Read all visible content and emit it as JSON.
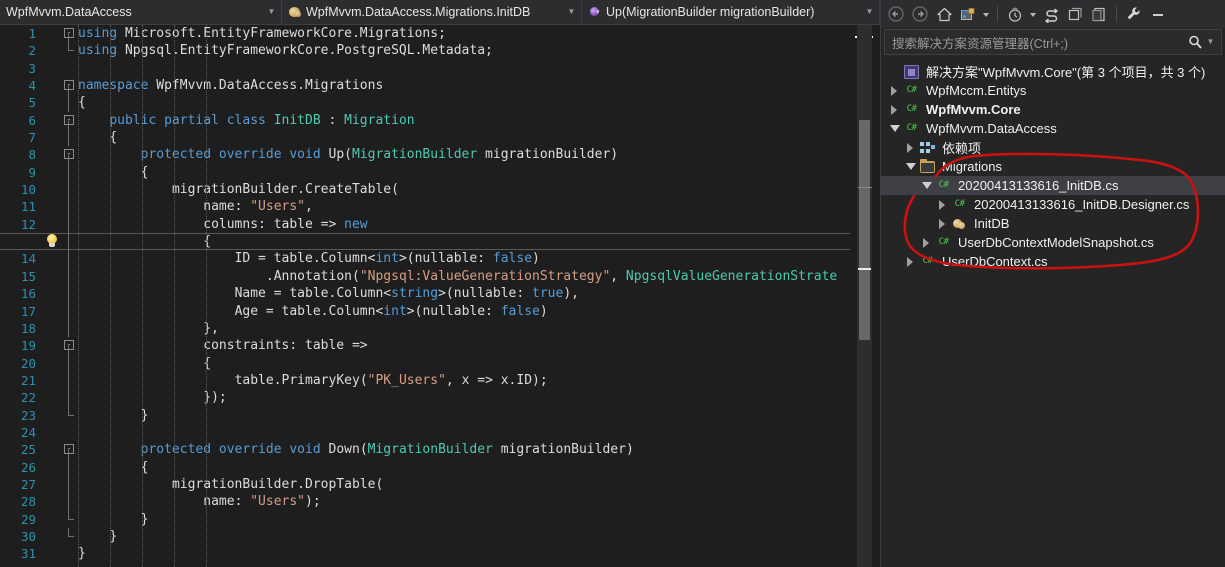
{
  "navbar": {
    "project_dropdown": "WpfMvvm.DataAccess",
    "type_dropdown": "WpfMvvm.DataAccess.Migrations.InitDB",
    "member_dropdown": "Up(MigrationBuilder migrationBuilder)",
    "accent_color": "#007acc"
  },
  "editor": {
    "language": "csharp",
    "current_line": 13,
    "background": "#1e1e1e",
    "line_number_color": "#2b91af",
    "colors": {
      "keyword": "#569cd6",
      "type": "#4ec9b0",
      "string": "#d69d85",
      "plain": "#dcdcdc"
    },
    "lines": [
      {
        "n": 1,
        "fold": "minus",
        "text": "using Microsoft.EntityFrameworkCore.Migrations;"
      },
      {
        "n": 2,
        "fold": "endbar",
        "text": "using Npgsql.EntityFrameworkCore.PostgreSQL.Metadata;"
      },
      {
        "n": 3,
        "fold": "",
        "text": ""
      },
      {
        "n": 4,
        "fold": "minus",
        "text": "namespace WpfMvvm.DataAccess.Migrations"
      },
      {
        "n": 5,
        "fold": "line",
        "text": "{"
      },
      {
        "n": 6,
        "fold": "minus",
        "text": "    public partial class InitDB : Migration"
      },
      {
        "n": 7,
        "fold": "line",
        "text": "    {"
      },
      {
        "n": 8,
        "fold": "minus",
        "text": "        protected override void Up(MigrationBuilder migrationBuilder)"
      },
      {
        "n": 9,
        "fold": "line",
        "text": "        {"
      },
      {
        "n": 10,
        "fold": "line",
        "text": "            migrationBuilder.CreateTable("
      },
      {
        "n": 11,
        "fold": "line",
        "text": "                name: \"Users\","
      },
      {
        "n": 12,
        "fold": "line",
        "text": "                columns: table => new"
      },
      {
        "n": 13,
        "fold": "line",
        "text": "                {"
      },
      {
        "n": 14,
        "fold": "line",
        "text": "                    ID = table.Column<int>(nullable: false)"
      },
      {
        "n": 15,
        "fold": "line",
        "text": "                        .Annotation(\"Npgsql:ValueGenerationStrategy\", NpgsqlValueGenerationStrate"
      },
      {
        "n": 16,
        "fold": "line",
        "text": "                    Name = table.Column<string>(nullable: true),"
      },
      {
        "n": 17,
        "fold": "line",
        "text": "                    Age = table.Column<int>(nullable: false)"
      },
      {
        "n": 18,
        "fold": "line",
        "text": "                },"
      },
      {
        "n": 19,
        "fold": "minus",
        "text": "                constraints: table =>"
      },
      {
        "n": 20,
        "fold": "line",
        "text": "                {"
      },
      {
        "n": 21,
        "fold": "line",
        "text": "                    table.PrimaryKey(\"PK_Users\", x => x.ID);"
      },
      {
        "n": 22,
        "fold": "line",
        "text": "                });"
      },
      {
        "n": 23,
        "fold": "endbar",
        "text": "        }"
      },
      {
        "n": 24,
        "fold": "",
        "text": ""
      },
      {
        "n": 25,
        "fold": "minus",
        "text": "        protected override void Down(MigrationBuilder migrationBuilder)"
      },
      {
        "n": 26,
        "fold": "line",
        "text": "        {"
      },
      {
        "n": 27,
        "fold": "line",
        "text": "            migrationBuilder.DropTable("
      },
      {
        "n": 28,
        "fold": "line",
        "text": "                name: \"Users\");"
      },
      {
        "n": 29,
        "fold": "endbar",
        "text": "        }"
      },
      {
        "n": 30,
        "fold": "endbar",
        "text": "    }"
      },
      {
        "n": 31,
        "fold": "",
        "text": "}"
      }
    ],
    "quick_action_bulb_line": 13
  },
  "solution_explorer": {
    "toolbar": {
      "back": "back-arrow",
      "forward": "forward-arrow",
      "home": "home",
      "show_all_files": "show-all-files",
      "show_all_files_caret": "chevron-down",
      "pending_changes": "pending-changes-clock",
      "pending_changes_caret": "chevron-down",
      "sync_with_active_document": "sync",
      "properties": "properties-window",
      "preview_selected_items": "preview-selected-items",
      "tool_options": "wrench",
      "minimize": "minimize"
    },
    "search_placeholder": "搜索解决方案资源管理器(Ctrl+;)",
    "tree": [
      {
        "indent": 0,
        "expander": "none",
        "icon": "solution-icon",
        "label": "解决方案\"WpfMvvm.Core\"(第 3 个项目，共 3 个)",
        "bold": false,
        "selected": false
      },
      {
        "indent": 0,
        "expander": "closed",
        "icon": "csharp-project-icon",
        "label": "WpfMccm.Entitys",
        "bold": false,
        "selected": false
      },
      {
        "indent": 0,
        "expander": "closed",
        "icon": "csharp-project-icon",
        "label": "WpfMvvm.Core",
        "bold": true,
        "selected": false
      },
      {
        "indent": 0,
        "expander": "open",
        "icon": "csharp-project-icon",
        "label": "WpfMvvm.DataAccess",
        "bold": false,
        "selected": false
      },
      {
        "indent": 1,
        "expander": "closed",
        "icon": "dependencies-icon",
        "label": "依赖项",
        "bold": false,
        "selected": false
      },
      {
        "indent": 1,
        "expander": "open",
        "icon": "folder-icon",
        "label": "Migrations",
        "bold": false,
        "selected": false
      },
      {
        "indent": 2,
        "expander": "open",
        "icon": "csharp-file-icon",
        "label": "20200413133616_InitDB.cs",
        "bold": false,
        "selected": true
      },
      {
        "indent": 3,
        "expander": "closed",
        "icon": "csharp-file-icon",
        "label": "20200413133616_InitDB.Designer.cs",
        "bold": false,
        "selected": false
      },
      {
        "indent": 3,
        "expander": "closed",
        "icon": "class-icon",
        "label": "InitDB",
        "bold": false,
        "selected": false
      },
      {
        "indent": 2,
        "expander": "closed",
        "icon": "csharp-file-icon",
        "label": "UserDbContextModelSnapshot.cs",
        "bold": false,
        "selected": false
      },
      {
        "indent": 1,
        "expander": "closed",
        "icon": "csharp-file-icon",
        "label": "UserDbContext.cs",
        "bold": false,
        "selected": false
      }
    ]
  },
  "annotation": {
    "type": "freehand-ellipse",
    "color": "#cc1111"
  }
}
